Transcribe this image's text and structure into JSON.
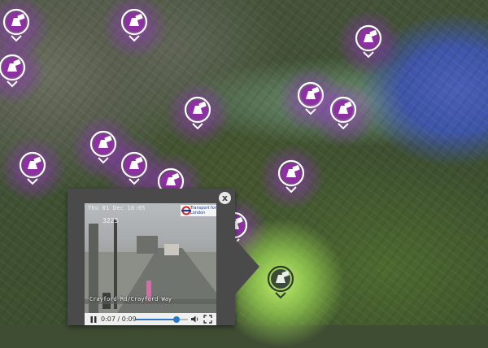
{
  "map": {
    "marker_icon": "traffic-camera-icon",
    "marker_count": 14,
    "colors": {
      "marker_purple": "#8e2fa3",
      "marker_glow": "#a03cc8",
      "selected_glow": "#c8ff6e",
      "selected_marker": "#3c4a3c",
      "water": "#4a5fb5"
    }
  },
  "popup": {
    "close_label": "x",
    "camera": {
      "timestamp": "Thu 01 Dec 10:05",
      "camera_number": "3223",
      "operator": "Transport for London",
      "location": "Crayford Rd/Crayford Way"
    },
    "player": {
      "current_time": "0:07",
      "duration": "0:09",
      "progress": 0.78,
      "volume_icon": "speaker-icon",
      "fullscreen_icon": "fullscreen-icon",
      "pause_icon": "pause-icon"
    }
  }
}
